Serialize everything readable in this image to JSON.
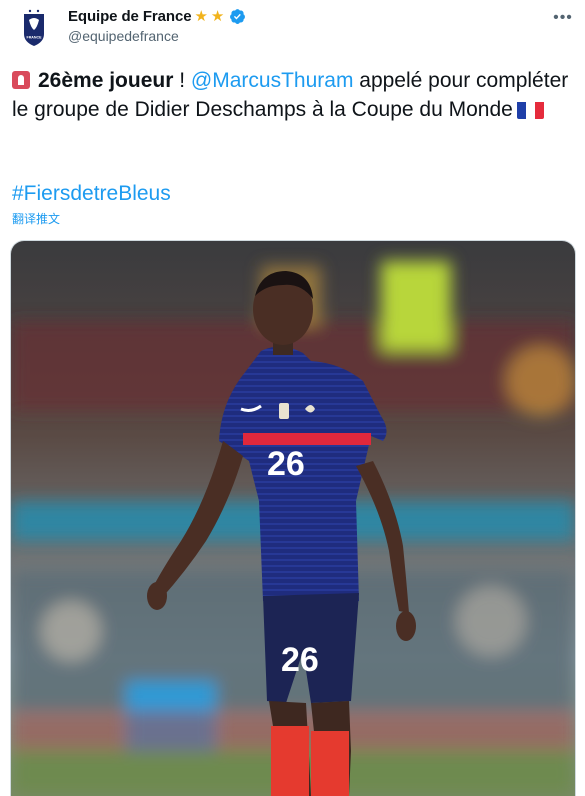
{
  "author": {
    "display_name": "Equipe de France",
    "handle": "@equipedefrance",
    "badges": [
      "star-icon",
      "star-icon",
      "verified-icon"
    ],
    "avatar_text": "FRANCE"
  },
  "tweet": {
    "emoji": "siren-icon",
    "bold_text": "26ème joueur",
    "text_after_bold": " ! ",
    "mention": "@MarcusThuram",
    "text_rest": " appelé pour compléter le groupe de Didier Deschamps à la Coupe du Monde",
    "flag": "france-flag-icon",
    "hashtag": "#FiersdetreBleus",
    "translate_label": "翻译推文"
  },
  "photo": {
    "shirt_number": "26",
    "shorts_number": "26"
  },
  "colors": {
    "link": "#1d9bf0",
    "jersey_navy": "#1d2a7a",
    "jersey_red": "#e0283c",
    "socks": "#e53a2f"
  }
}
